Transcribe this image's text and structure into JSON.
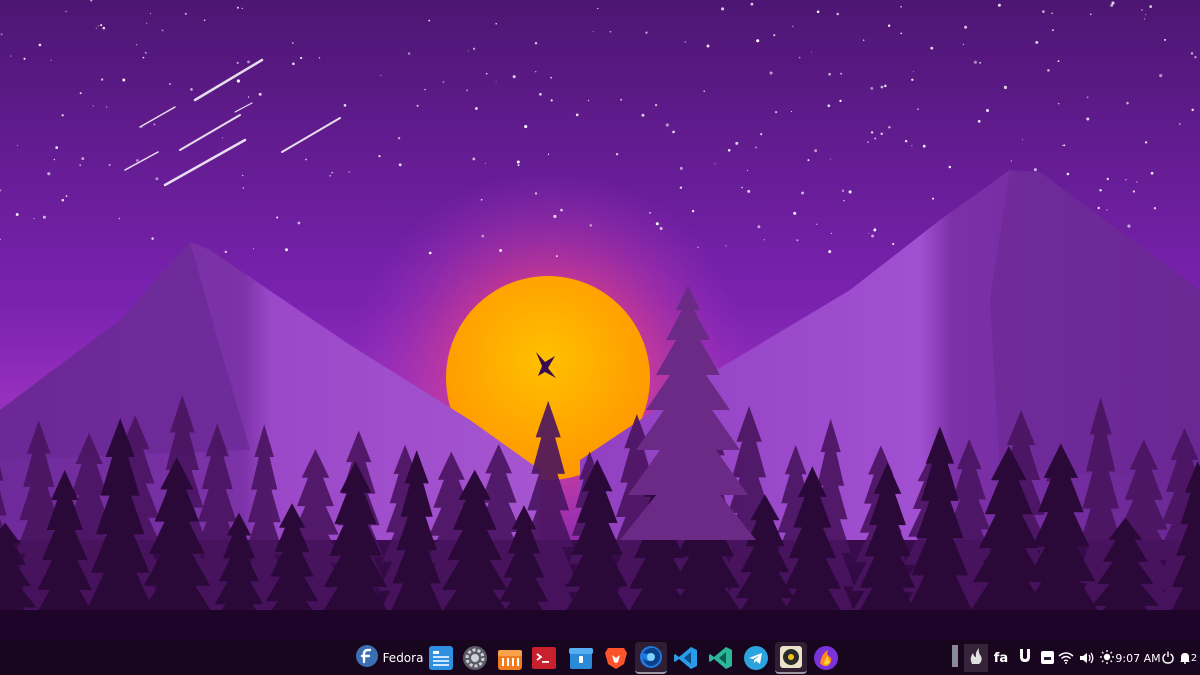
{
  "panel": {
    "start": {
      "label": "Fedora",
      "icon": "fedora-logo-icon"
    },
    "apps": [
      {
        "name": "files",
        "icon": "file-manager-icon"
      },
      {
        "name": "settings",
        "icon": "settings-gear-icon"
      },
      {
        "name": "software",
        "icon": "software-store-icon"
      },
      {
        "name": "terminal",
        "icon": "terminal-icon"
      },
      {
        "name": "archive",
        "icon": "archive-icon"
      },
      {
        "name": "brave",
        "icon": "brave-browser-icon"
      },
      {
        "name": "firefox",
        "icon": "firefox-icon",
        "active": true
      },
      {
        "name": "vscode",
        "icon": "vscode-icon"
      },
      {
        "name": "vscodium",
        "icon": "vscodium-icon"
      },
      {
        "name": "telegram",
        "icon": "telegram-icon"
      },
      {
        "name": "music",
        "icon": "music-player-icon",
        "active": true
      },
      {
        "name": "firefox-dev",
        "icon": "firefox-developer-icon"
      }
    ],
    "tray": {
      "keyboard_layout": "fa",
      "clock": "9:07 AM",
      "notification_count": "2",
      "icons": [
        "show-desktop-icon",
        "flame-icon",
        "magnet-icon",
        "storage-icon",
        "wifi-icon",
        "volume-icon",
        "brightness-icon",
        "power-icon",
        "notification-bell-icon"
      ]
    }
  },
  "colors": {
    "sky_top": "#4a1470",
    "sky_mid": "#8a2ac0",
    "sun": "#ffb300",
    "mountain": "#8e3fbf",
    "trees": "#2a0838"
  }
}
